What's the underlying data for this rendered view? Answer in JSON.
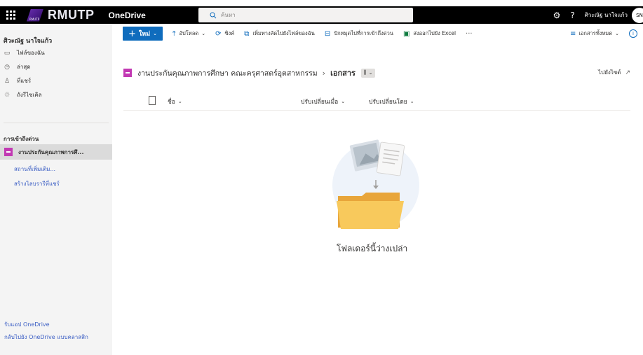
{
  "topbar": {
    "brand": "RMUTP",
    "logo_small_text": "RMUTP",
    "app_name": "OneDrive",
    "search_placeholder": "ค้นหา",
    "user_name": "ศิวะณัฐ นาใจแก้ว",
    "avatar_initials": "SN"
  },
  "sidebar": {
    "user_name": "ศิวะณัฐ นาใจแก้ว",
    "items": [
      {
        "label": "ไฟล์ของฉัน",
        "icon": "folder-icon"
      },
      {
        "label": "ล่าสุด",
        "icon": "clock-icon"
      },
      {
        "label": "ที่แชร์",
        "icon": "people-icon"
      },
      {
        "label": "ถังรีไซเคิล",
        "icon": "recycle-bin-icon"
      }
    ],
    "quick_access_title": "การเข้าถึงด่วน",
    "quick_access_selected": "งานประกันคุณภาพการศึ...",
    "more_places": "สถานที่เพิ่มเติม...",
    "create_shared_library": "สร้างไลบรารีที่แชร์",
    "get_onedrive_apps": "รับแอป OneDrive",
    "back_to_classic": "กลับไปยัง OneDrive แบบคลาสสิก"
  },
  "commandbar": {
    "new_label": "ใหม่",
    "upload": "อัปโหลด",
    "sync": "ซิงค์",
    "add_shortcut": "เพิ่มทางลัดไปยังไฟล์ของฉัน",
    "pin_quick_access": "ปักหมุดไปที่การเข้าถึงด่วน",
    "export_excel": "ส่งออกไปยัง Excel",
    "more": "···",
    "all_documents": "เอกสารทั้งหมด"
  },
  "breadcrumb": {
    "site": "งานประกันคุณภาพการศึกษา คณะครุศาสตร์อุตสาหกรรม",
    "current": "เอกสาร",
    "go_to_site": "ไปยังไซต์"
  },
  "columns": {
    "name": "ชื่อ",
    "modified": "ปรับเปลี่ยนเมื่อ",
    "modified_by": "ปรับเปลี่ยนโดย"
  },
  "empty_state": {
    "message": "โฟลเดอร์นี้ว่างเปล่า"
  },
  "colors": {
    "topbar": "#000000",
    "accent": "#0f6cbd",
    "site_tile": "#c239b3",
    "sidebar": "#f4f4f4",
    "link": "#3b5ec4"
  }
}
